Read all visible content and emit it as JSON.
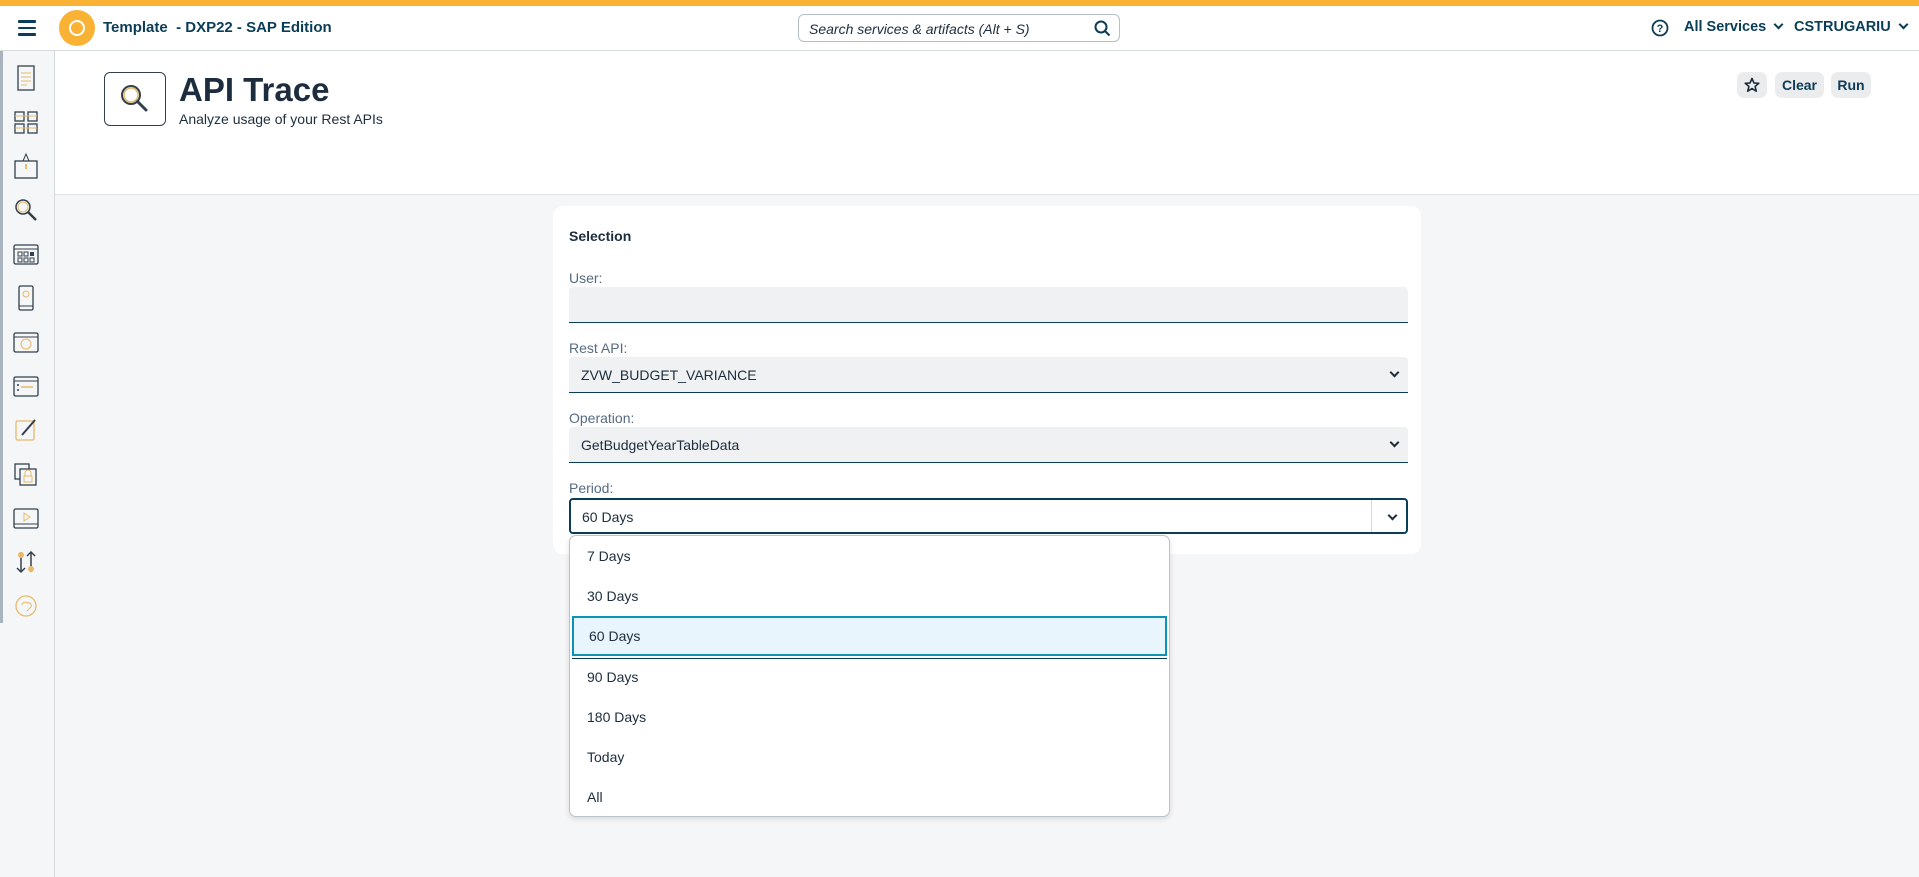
{
  "shell": {
    "app_title": "Template  - DXP22 - SAP Edition",
    "search_placeholder": "Search services & artifacts (Alt + S)",
    "services_label": "All Services",
    "user_label": "CSTRUGARIU"
  },
  "sidebar": {
    "items": [
      "document-icon",
      "tiles-icon",
      "launch-icon",
      "search-icon",
      "apps-grid-icon",
      "mobile-icon",
      "theme-palette-icon",
      "list-window-icon",
      "edit-icon",
      "lock-copy-icon",
      "video-icon",
      "transport-icon",
      "heart-refresh-icon"
    ]
  },
  "page": {
    "title": "API Trace",
    "subtitle": "Analyze usage of your Rest APIs",
    "actions": {
      "clear": "Clear",
      "run": "Run"
    }
  },
  "selection": {
    "heading": "Selection",
    "user_label": "User:",
    "user_value": "",
    "rest_api_label": "Rest API:",
    "rest_api_value": "ZVW_BUDGET_VARIANCE",
    "operation_label": "Operation:",
    "operation_value": "GetBudgetYearTableData",
    "period_label": "Period:",
    "period_value": "60 Days",
    "period_options": [
      "7 Days",
      "30 Days",
      "60 Days",
      "90 Days",
      "180 Days",
      "Today",
      "All"
    ],
    "period_selected_index": 2
  },
  "colors": {
    "accent": "#f9b234",
    "brand": "#0a3d57",
    "selected_item": "#e9f5fd",
    "focus": "#0d94b3"
  }
}
